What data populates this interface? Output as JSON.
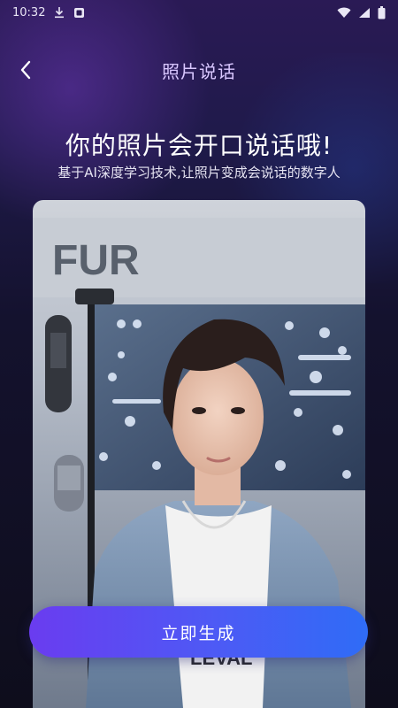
{
  "status_bar": {
    "time": "10:32",
    "icons": [
      "download-icon",
      "app-notification-icon",
      "wifi-icon",
      "signal-icon",
      "battery-icon"
    ]
  },
  "nav": {
    "back_icon": "chevron-left-icon",
    "title": "照片说话"
  },
  "hero": {
    "headline": "你的照片会开口说话哦!",
    "subline": "基于AI深度学习技术,让照片变成会说话的数字人"
  },
  "photo": {
    "sign_text": "FUR",
    "shirt_text": "LEVAL",
    "description_icon": "portrait-photo"
  },
  "action": {
    "generate_label": "立即生成"
  },
  "colors": {
    "title_purple": "#d9c7ff",
    "button_start": "#6a3cf0",
    "button_end": "#2f6cf6",
    "background_top": "#2a1a55",
    "background_bottom": "#0e0d1c"
  }
}
